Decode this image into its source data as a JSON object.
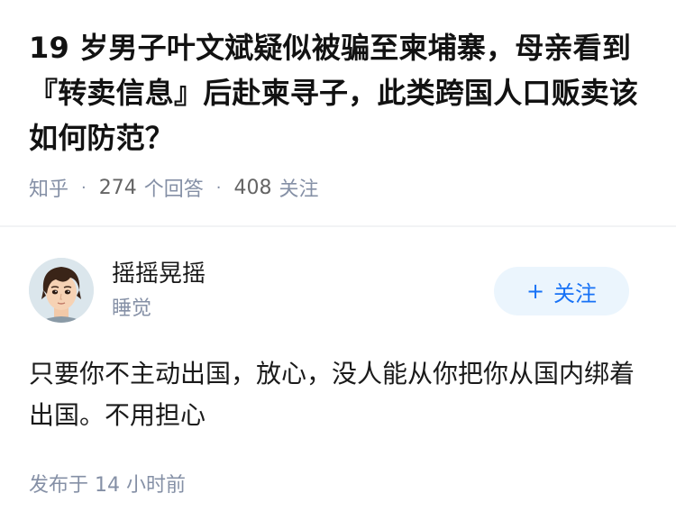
{
  "question": {
    "title": "19 岁男子叶文斌疑似被骗至柬埔寨，母亲看到『转卖信息』后赴柬寻子，此类跨国人口贩卖该如何防范？",
    "source": "知乎",
    "answer_count": "274",
    "answer_label": "个回答",
    "follow_count": "408",
    "follow_label": "关注"
  },
  "author": {
    "name": "摇摇晃摇",
    "subtitle": "睡觉",
    "follow_button": "关注",
    "follow_icon": "plus-icon"
  },
  "answer": {
    "content": "只要你不主动出国，放心，没人能从你把你从国内绑着出国。不用担心",
    "published": "发布于  14 小时前"
  },
  "colors": {
    "accent": "#1772f6",
    "button_bg": "#ebf5fd",
    "meta_gray": "#8590a6",
    "text": "#1a1a1a"
  }
}
